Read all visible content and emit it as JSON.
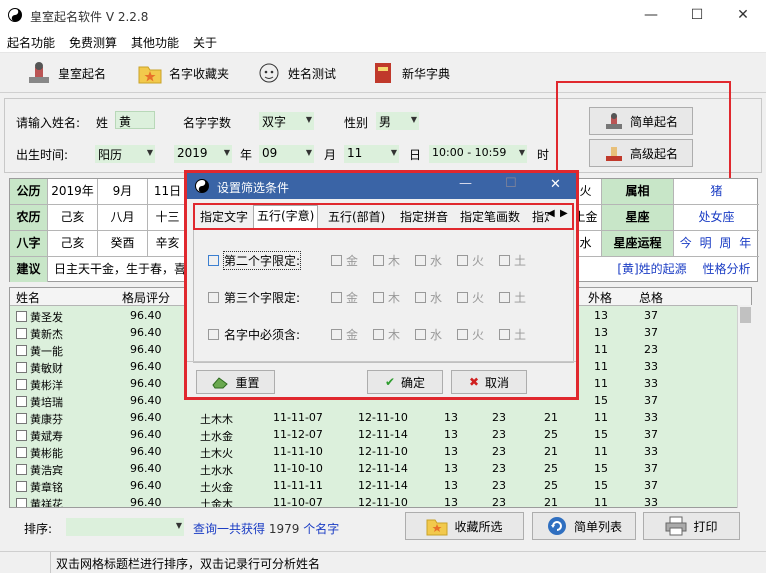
{
  "window": {
    "title": "皇室起名软件 V 2.2.8"
  },
  "menu": [
    "起名功能",
    "免费测算",
    "其他功能",
    "关于"
  ],
  "toolbar": {
    "royal": "皇室起名",
    "fav": "名字收藏夹",
    "test": "姓名测试",
    "dict": "新华字典"
  },
  "form": {
    "name_label": "请输入姓名:",
    "surname_label": "姓",
    "surname": "黄",
    "count_label": "名字字数",
    "count": "双字",
    "gender_label": "性别",
    "gender": "男",
    "birth_label": "出生时间:",
    "calendar": "阳历",
    "year": "2019",
    "year_label": "年",
    "month": "09",
    "month_label": "月",
    "day": "11",
    "day_label": "日",
    "time": "10:00 - 10:59",
    "time_label": "时",
    "simple_btn": "简单起名",
    "advanced_btn": "高级起名"
  },
  "info": {
    "r1": [
      "公历",
      "2019年",
      "9月",
      "11日"
    ],
    "r2": [
      "农历",
      "己亥",
      "八月",
      "十三"
    ],
    "r3": [
      "八字",
      "己亥",
      "癸酉",
      "辛亥"
    ],
    "r4": [
      "建议",
      "日主天干金，生于春，喜"
    ],
    "r1_tail": [
      "火",
      "属相",
      "猪"
    ],
    "r2_tail": [
      "土金",
      "星座",
      "处女座"
    ],
    "r3_tail": [
      "水",
      "星座运程",
      "今 明 周 年"
    ],
    "r4_tail": [
      "[黄]姓的起源",
      "性格分析"
    ]
  },
  "list": {
    "headers": [
      "姓名",
      "格局评分",
      "外格",
      "总格"
    ],
    "rows": [
      {
        "name": "黄圣发",
        "score": "96.40",
        "wx": "",
        "a": "",
        "b": "",
        "c": "",
        "d": "",
        "e": "",
        "w": "13",
        "t": "37"
      },
      {
        "name": "黄新杰",
        "score": "96.40",
        "wx": "",
        "a": "",
        "b": "",
        "c": "",
        "d": "",
        "e": "",
        "w": "13",
        "t": "37"
      },
      {
        "name": "黄一能",
        "score": "96.40",
        "wx": "",
        "a": "",
        "b": "",
        "c": "",
        "d": "",
        "e": "",
        "w": "11",
        "t": "23"
      },
      {
        "name": "黄敏财",
        "score": "96.40",
        "wx": "",
        "a": "",
        "b": "",
        "c": "",
        "d": "",
        "e": "",
        "w": "11",
        "t": "33"
      },
      {
        "name": "黄彬洋",
        "score": "96.40",
        "wx": "",
        "a": "",
        "b": "",
        "c": "",
        "d": "",
        "e": "",
        "w": "11",
        "t": "33"
      },
      {
        "name": "黄培瑞",
        "score": "96.40",
        "wx": "",
        "a": "",
        "b": "",
        "c": "",
        "d": "",
        "e": "",
        "w": "15",
        "t": "37"
      },
      {
        "name": "黄康芬",
        "score": "96.40",
        "wx": "土木木",
        "a": "11-11-07",
        "b": "12-11-10",
        "c": "13",
        "d": "23",
        "e": "21",
        "w": "11",
        "t": "33"
      },
      {
        "name": "黄斌寿",
        "score": "96.40",
        "wx": "土水金",
        "a": "11-12-07",
        "b": "12-11-14",
        "c": "13",
        "d": "23",
        "e": "25",
        "w": "15",
        "t": "37"
      },
      {
        "name": "黄彬能",
        "score": "96.40",
        "wx": "土木火",
        "a": "11-11-10",
        "b": "12-11-10",
        "c": "13",
        "d": "23",
        "e": "21",
        "w": "11",
        "t": "33"
      },
      {
        "name": "黄浩宾",
        "score": "96.40",
        "wx": "土水水",
        "a": "11-10-10",
        "b": "12-11-14",
        "c": "13",
        "d": "23",
        "e": "25",
        "w": "15",
        "t": "37"
      },
      {
        "name": "黄章铭",
        "score": "96.40",
        "wx": "土火金",
        "a": "11-11-11",
        "b": "12-11-14",
        "c": "13",
        "d": "23",
        "e": "25",
        "w": "15",
        "t": "37"
      },
      {
        "name": "黄祥花",
        "score": "96.40",
        "wx": "土金木",
        "a": "11-10-07",
        "b": "12-11-10",
        "c": "13",
        "d": "23",
        "e": "21",
        "w": "11",
        "t": "33"
      }
    ]
  },
  "bottom": {
    "sort_label": "排序:",
    "count_text": "查询一共获得",
    "count": "1979",
    "count_unit": "个名字",
    "collect": "收藏所选",
    "simple_list": "简单列表",
    "print": "打印"
  },
  "status": "双击网格标题栏进行排序，双击记录行可分析姓名",
  "dialog": {
    "title": "设置筛选条件",
    "tabs": [
      "指定文字",
      "五行(字意)",
      "五行(部首)",
      "指定拼音",
      "指定笔画数",
      "指定"
    ],
    "rows": [
      "第二个字限定:",
      "第三个字限定:",
      "名字中必须含:"
    ],
    "elements": [
      "金",
      "木",
      "水",
      "火",
      "土"
    ],
    "reset": "重置",
    "ok": "确定",
    "cancel": "取消"
  }
}
